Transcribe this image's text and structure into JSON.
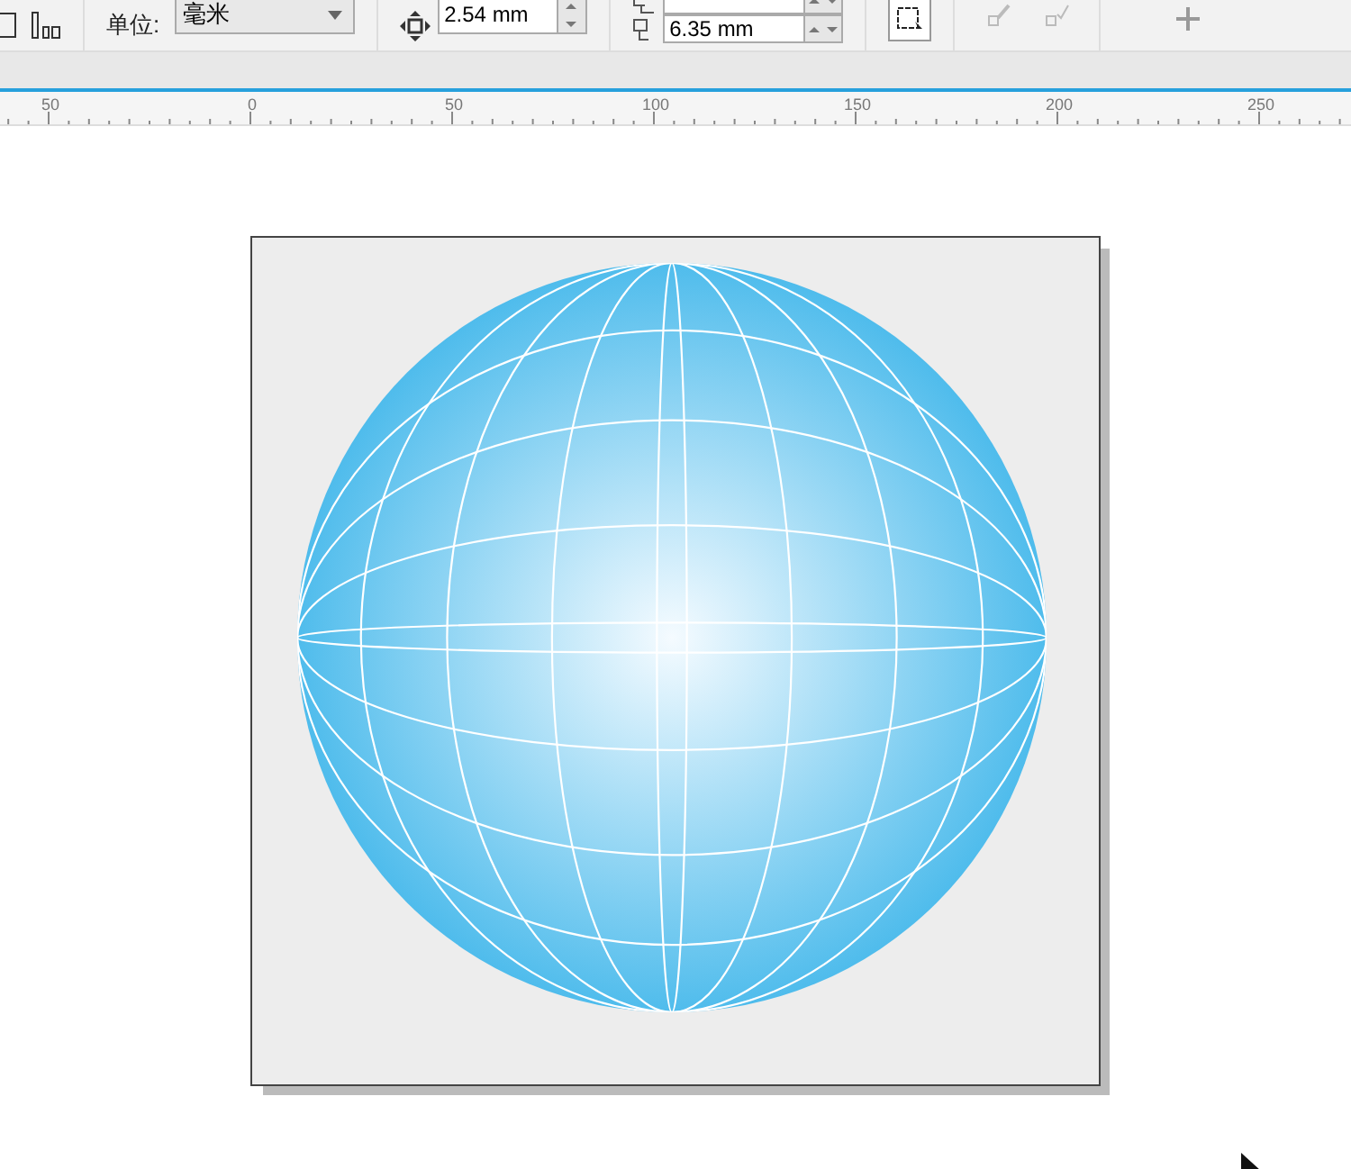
{
  "toolbar": {
    "unit_label": "单位:",
    "unit_value": "毫米",
    "nudge_value": "2.54 mm",
    "duplicate_y": "6.35 mm"
  },
  "ruler": {
    "labels": [
      "50",
      "0",
      "50",
      "100",
      "150",
      "200",
      "250"
    ]
  }
}
